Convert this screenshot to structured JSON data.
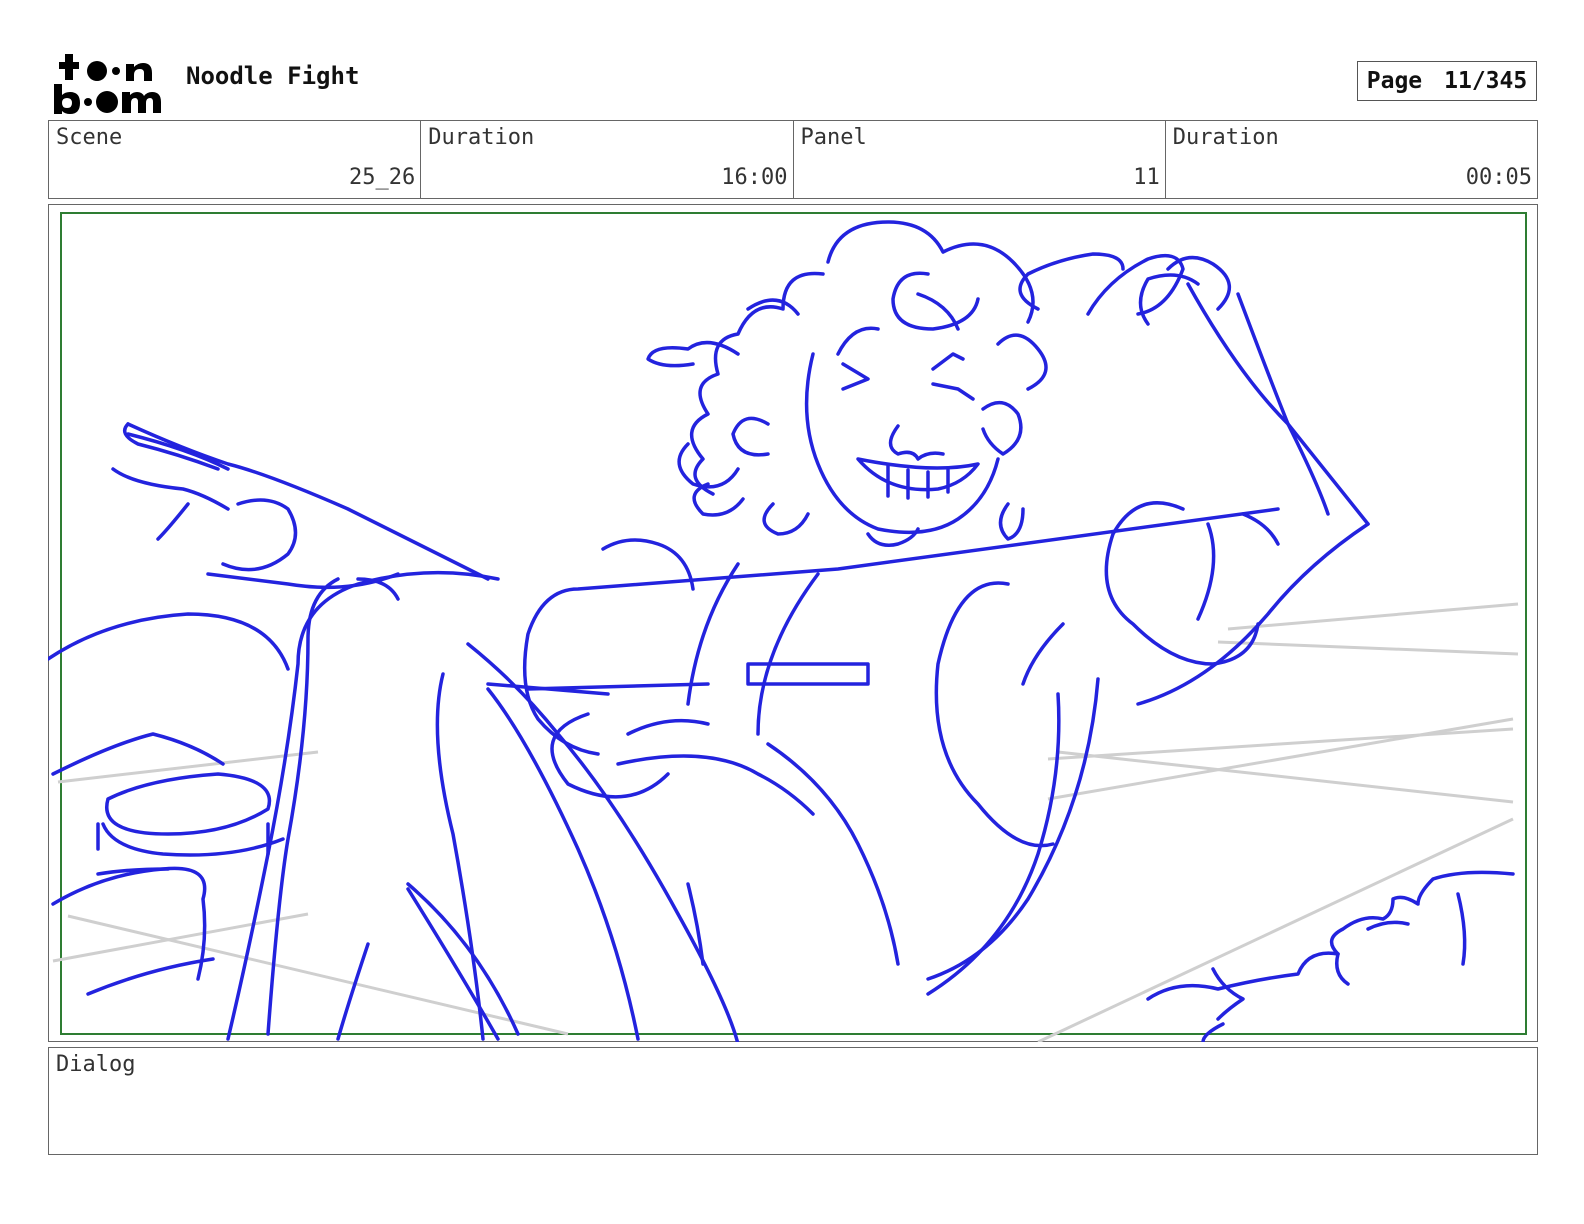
{
  "header": {
    "project_title": "Noodle Fight",
    "page_label": "Page",
    "page_value": "11/345",
    "logo_text_top": "toon",
    "logo_text_bottom": "boom"
  },
  "info": {
    "scene_label": "Scene",
    "scene_value": "25_26",
    "scene_duration_label": "Duration",
    "scene_duration_value": "16:00",
    "panel_label": "Panel",
    "panel_value": "11",
    "panel_duration_label": "Duration",
    "panel_duration_value": "00:05"
  },
  "dialog": {
    "label": "Dialog",
    "text": ""
  },
  "colors": {
    "sketch_line": "#2020e0",
    "guide_line": "#cccccc",
    "safe_frame": "#2e7d32"
  }
}
